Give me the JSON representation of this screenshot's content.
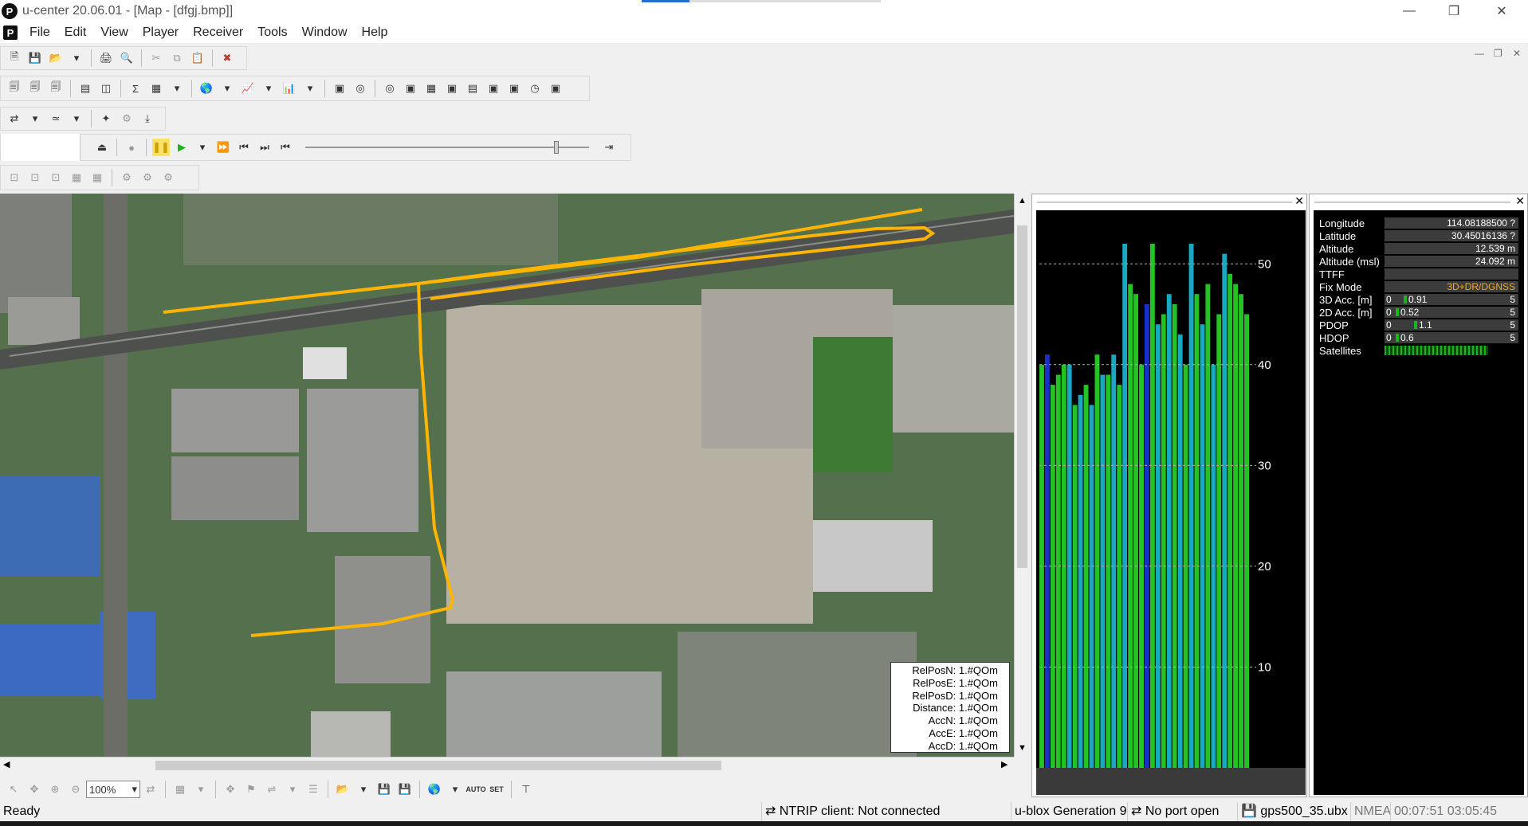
{
  "window": {
    "title": "u-center 20.06.01 - [Map - [dfgj.bmp]]",
    "icon": "P"
  },
  "menu": [
    "File",
    "Edit",
    "View",
    "Player",
    "Receiver",
    "Tools",
    "Window",
    "Help"
  ],
  "map": {
    "info": [
      "RelPosN: 1.#QOm",
      "RelPosE: 1.#QOm",
      "RelPosD: 1.#QOm",
      "Distance: 1.#QOm",
      "AccN: 1.#QOm",
      "AccE: 1.#QOm",
      "AccD: 1.#QOm"
    ],
    "zoom": "100%"
  },
  "chart_data": {
    "type": "bar",
    "title": "",
    "xlabel": "",
    "ylabel": "",
    "ylim": [
      0,
      55
    ],
    "yticks": [
      10,
      20,
      30,
      40,
      50
    ],
    "series": [
      {
        "values": [
          40,
          41,
          38,
          39,
          40,
          40,
          36,
          37,
          38,
          36,
          41,
          39,
          39,
          41,
          38,
          52,
          48,
          47,
          40,
          46,
          52,
          44,
          45,
          47,
          46,
          43,
          40,
          52,
          47,
          44,
          48,
          40,
          45,
          51,
          49,
          48,
          47,
          45
        ]
      }
    ],
    "colors": {
      "green": "#22c322",
      "cyan": "#1aa7c2",
      "blue": "#1730c9",
      "background": "#000000"
    }
  },
  "nav_data": {
    "longitude": {
      "label": "Longitude",
      "value": "114.08188500 ?"
    },
    "latitude": {
      "label": "Latitude",
      "value": "30.45016136 ?"
    },
    "altitude": {
      "label": "Altitude",
      "value": "12.539 m"
    },
    "altitude_msl": {
      "label": "Altitude (msl)",
      "value": "24.092 m"
    },
    "ttff": {
      "label": "TTFF",
      "value": ""
    },
    "fix_mode": {
      "label": "Fix Mode",
      "value": "3D+DR/DGNSS"
    },
    "acc3d": {
      "label": "3D Acc. [m]",
      "min": "0",
      "value": "0.91",
      "max": "5"
    },
    "acc2d": {
      "label": "2D Acc. [m]",
      "min": "0",
      "value": "0.52",
      "max": "5"
    },
    "pdop": {
      "label": "PDOP",
      "min": "0",
      "value": "1.1",
      "max": "5"
    },
    "hdop": {
      "label": "HDOP",
      "min": "0",
      "value": "0.6",
      "max": "5"
    },
    "satellites": {
      "label": "Satellites"
    },
    "colors": {
      "fix": "#f5a623",
      "bar": "#1db31d"
    }
  },
  "status": {
    "ready": "Ready",
    "ntrip": "NTRIP client: Not connected",
    "generation": "u-blox Generation 9",
    "port": "No port open",
    "file": "gps500_35.ubx",
    "protocol": "NMEA",
    "time": "00:07:51 03:05:45"
  }
}
